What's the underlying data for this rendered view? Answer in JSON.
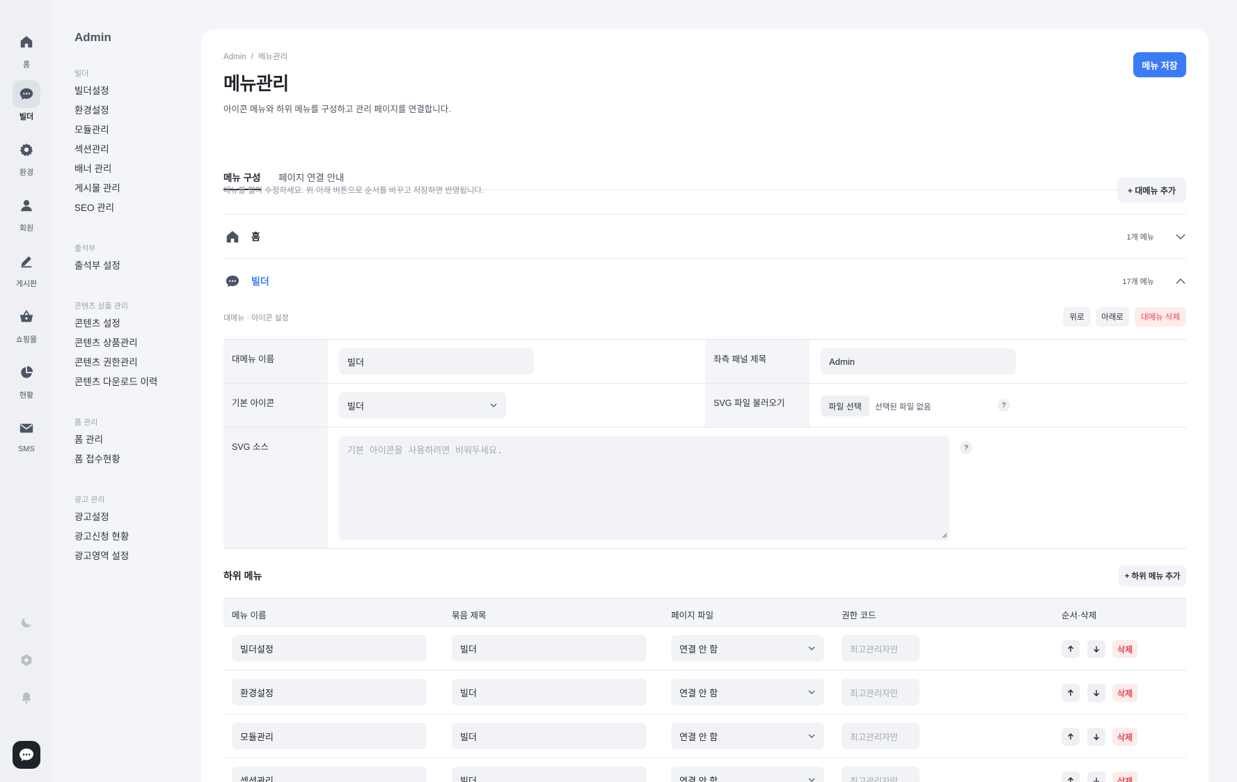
{
  "rail": {
    "items": [
      {
        "label": "홈",
        "icon": "home-icon"
      },
      {
        "label": "빌더",
        "icon": "chat-bubble-icon",
        "active": true
      },
      {
        "label": "환경",
        "icon": "gear-icon"
      },
      {
        "label": "회원",
        "icon": "user-icon"
      },
      {
        "label": "게시판",
        "icon": "pencil-icon"
      },
      {
        "label": "쇼핑몰",
        "icon": "basket-icon"
      },
      {
        "label": "현황",
        "icon": "pie-chart-icon"
      },
      {
        "label": "SMS",
        "icon": "mail-icon"
      }
    ],
    "bottom": [
      "moon-icon",
      "settings-icon",
      "bell-icon",
      "chat-bubble-icon"
    ]
  },
  "sidebar": {
    "title": "Admin",
    "groups": [
      {
        "heading": "빌더",
        "links": [
          "빌더설정",
          "환경설정",
          "모듈관리",
          "섹션관리",
          "배너 관리",
          "게시물 관리",
          "SEO 관리"
        ]
      },
      {
        "heading": "출석부",
        "links": [
          "출석부 설정"
        ]
      },
      {
        "heading": "콘텐츠 상품 관리",
        "links": [
          "콘텐츠 설정",
          "콘텐츠 상품관리",
          "콘텐츠 권한관리",
          "콘텐츠 다운로드 이력"
        ]
      },
      {
        "heading": "폼 관리",
        "links": [
          "폼 관리",
          "폼 접수현황"
        ]
      },
      {
        "heading": "광고 관리",
        "links": [
          "광고설정",
          "광고신청 현황",
          "광고영역 설정"
        ]
      }
    ]
  },
  "page": {
    "breadcrumb": [
      "Admin",
      "메뉴관리"
    ],
    "breadcrumb_sep": "/",
    "title": "메뉴관리",
    "description": "아이콘 메뉴와 하위 메뉴를 구성하고 관리 페이지를 연결합니다.",
    "save_label": "메뉴 저장",
    "tabs": [
      "메뉴 구성",
      "페이지 연결 안내"
    ],
    "hint": "메뉴를 펼쳐 수정하세요. 위·아래 버튼으로 순서를 바꾸고 저장하면 반영됩니다.",
    "add_top_label": "+ 대메뉴 추가"
  },
  "menus": [
    {
      "name": "홈",
      "count": "1개 메뉴",
      "icon": "home-icon",
      "open": false
    },
    {
      "name": "빌더",
      "count": "17개 메뉴",
      "icon": "chat-bubble-icon",
      "open": true
    }
  ],
  "editor": {
    "section_label": "대메뉴 · 아이콘 설정",
    "up_label": "위로",
    "down_label": "아래로",
    "delete_label": "대메뉴 삭제",
    "fields": {
      "name_label": "대메뉴 이름",
      "name_value": "빌더",
      "panel_title_label": "좌측 패널 제목",
      "panel_title_value": "Admin",
      "icon_label": "기본 아이콘",
      "icon_value": "빌더",
      "svg_file_label": "SVG 파일 불러오기",
      "file_button": "파일 선택",
      "file_none": "선택된 파일 없음",
      "svg_source_label": "SVG 소스",
      "svg_source_placeholder": "기본 아이콘을 사용하려면 비워두세요.",
      "help": "?"
    }
  },
  "submenu": {
    "title": "하위 메뉴",
    "add_label": "+ 하위 메뉴 추가",
    "columns": [
      "메뉴 이름",
      "묶음 제목",
      "페이지 파일",
      "권한 코드",
      "순서·삭제"
    ],
    "rows": [
      {
        "name": "빌더설정",
        "group": "빌더",
        "page": "연결 안 함",
        "perm": "최고관리자만"
      },
      {
        "name": "환경설정",
        "group": "빌더",
        "page": "연결 안 함",
        "perm": "최고관리자만"
      },
      {
        "name": "모듈관리",
        "group": "빌더",
        "page": "연결 안 함",
        "perm": "최고관리자만"
      },
      {
        "name": "섹션관리",
        "group": "빌더",
        "page": "연결 안 함",
        "perm": "최고관리자만"
      }
    ],
    "delete_label": "삭제"
  },
  "colors": {
    "accent": "#3b7bf6",
    "danger": "#e5484d",
    "rail": "#eef0f4",
    "icon": "#4b5563"
  }
}
